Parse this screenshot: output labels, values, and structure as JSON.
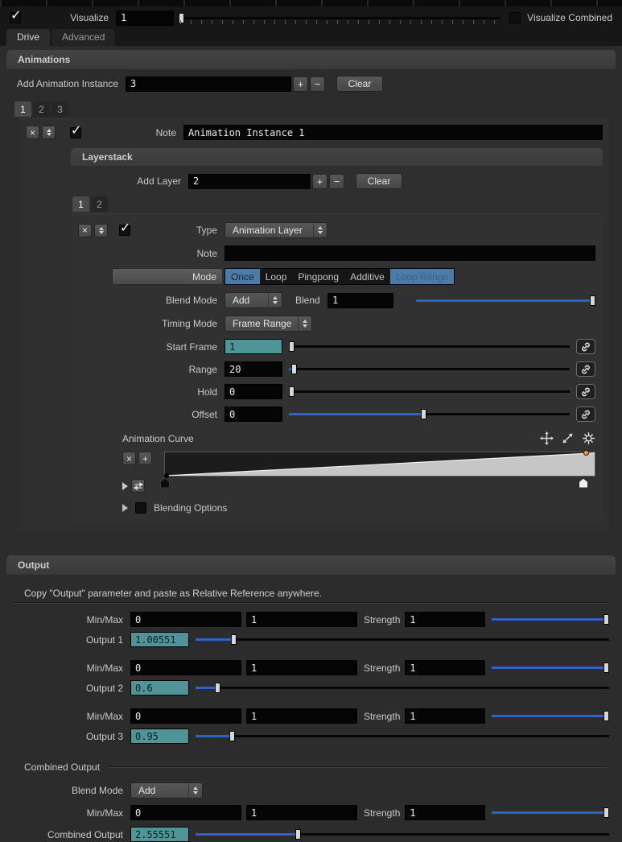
{
  "icons": {
    "check": "✓",
    "close": "×",
    "plus": "+",
    "minus": "−"
  },
  "top": {
    "visualize_label": "Visualize",
    "visualize_value": "1",
    "visualize_slider_pct": 1,
    "visualize_combined_label": "Visualize Combined"
  },
  "tabs": {
    "drive": "Drive",
    "advanced": "Advanced"
  },
  "animations": {
    "title": "Animations",
    "add_instance_label": "Add Animation Instance",
    "add_instance_value": "3",
    "clear_label": "Clear",
    "instance_tabs": {
      "t1": "1",
      "t2": "2",
      "t3": "3"
    },
    "instance": {
      "note_label": "Note",
      "note_value": "Animation Instance 1",
      "layerstack": {
        "title": "Layerstack",
        "add_layer_label": "Add Layer",
        "add_layer_value": "2",
        "clear_label": "Clear",
        "layer_tabs": {
          "t1": "1",
          "t2": "2"
        },
        "layer": {
          "type_label": "Type",
          "type_value": "Animation Layer",
          "note_label": "Note",
          "note_value": "",
          "mode_label": "Mode",
          "modes": {
            "m0": "Once",
            "m1": "Loop",
            "m2": "Pingpong",
            "m3": "Additive",
            "m4": "Loop Range"
          },
          "blend_mode_label": "Blend Mode",
          "blend_mode_value": "Add",
          "blend_label": "Blend",
          "blend_value": "1",
          "blend_slider_pct": 100,
          "timing_mode_label": "Timing Mode",
          "timing_mode_value": "Frame Range",
          "start_frame_label": "Start Frame",
          "start_frame_value": "1",
          "start_frame_pct": 0,
          "range_label": "Range",
          "range_value": "20",
          "range_pct": 3,
          "hold_label": "Hold",
          "hold_value": "0",
          "hold_pct": 0,
          "offset_label": "Offset",
          "offset_value": "0",
          "offset_pct": 49,
          "animation_curve_label": "Animation Curve",
          "blending_options_label": "Blending Options"
        }
      }
    }
  },
  "output": {
    "title": "Output",
    "copy_hint": "Copy \"Output\" parameter and paste as Relative Reference anywhere.",
    "minmax_label": "Min/Max",
    "strength_label": "Strength",
    "strength_slider_pct": 100,
    "groups": {
      "g1": {
        "min": "0",
        "max": "1",
        "strength": "1",
        "label": "Output 1",
        "value": "1.00551",
        "pct": 10
      },
      "g2": {
        "min": "0",
        "max": "1",
        "strength": "1",
        "label": "Output 2",
        "value": "0.6",
        "pct": 6
      },
      "g3": {
        "min": "0",
        "max": "1",
        "strength": "1",
        "label": "Output 3",
        "value": "0.95",
        "pct": 9.5
      }
    },
    "combined": {
      "title": "Combined Output",
      "blend_mode_label": "Blend Mode",
      "blend_mode_value": "Add",
      "minmax_label": "Min/Max",
      "min": "0",
      "max": "1",
      "strength": "1",
      "label": "Combined Output",
      "value": "2.55551",
      "pct": 25.5
    }
  }
}
